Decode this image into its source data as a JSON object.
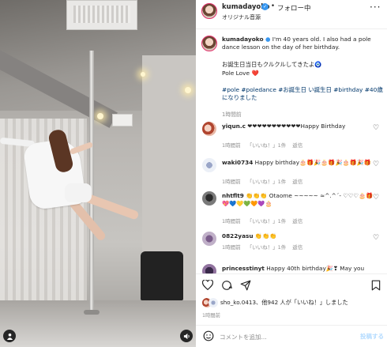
{
  "header": {
    "username": "kumadayoko",
    "separator": "•",
    "follow_status": "フォロー中",
    "audio": "オリジナル音源",
    "more": "···"
  },
  "caption": {
    "username": "kumadayoko",
    "text_en": "I'm 40 years old. I also had a pole dance lesson on the day of her birthday.",
    "text_jp": "お誕生日当日もクルクルしてきたよ🧿",
    "text_love": "Pole Love ❤️",
    "hashtags": "#pole #poledance #お誕生日 い誕生日 #birthday #40歳になりました",
    "time": "1時間前"
  },
  "comments": [
    {
      "username": "yiqun.c",
      "text": "❤❤❤❤❤❤❤❤❤❤❤Happy Birthday",
      "time": "1時間前",
      "likes": "「いいね！」1件",
      "reply": "返信"
    },
    {
      "username": "waki0734",
      "text": "Happy birthday🎂🎁🎉🎂🎁🎉🎂🎁🎉🎁",
      "time": "1時間前",
      "likes": "「いいね！」1件",
      "reply": "返信"
    },
    {
      "username": "nhtflt9",
      "text": "👏👏👏 Otaome ~~~~~ ≈^.^´- ♡♡♡🎂🎁💖💙💛💚🧡💜🎂",
      "time": "1時間前",
      "likes": "「いいね！」1件",
      "reply": "返信"
    },
    {
      "username": "0822yasu",
      "text": "👏👏👏",
      "time": "1時間前",
      "likes": "「いいね！」1件",
      "reply": "返信"
    },
    {
      "username": "princesstinyt",
      "text": "Happy 40th birthday🎉❣ May you",
      "time": "",
      "likes": "",
      "reply": ""
    }
  ],
  "likes": {
    "text": "sho_ko.0413、他942 人が「いいね！」しました"
  },
  "post_time": "1時間前",
  "comment_bar": {
    "placeholder": "コメントを追加...",
    "post_label": "投稿する"
  },
  "icons": {
    "verified": "verified-badge-icon",
    "heart": "heart-icon",
    "comment": "comment-icon",
    "share": "share-icon",
    "save": "bookmark-icon",
    "emoji": "emoji-icon",
    "user_tag": "user-tag-icon",
    "mute": "speaker-icon"
  },
  "colors": {
    "link": "#00376b",
    "verified": "#3897f0",
    "muted": "#8e8e8e",
    "post_button": "#b3dbff"
  }
}
